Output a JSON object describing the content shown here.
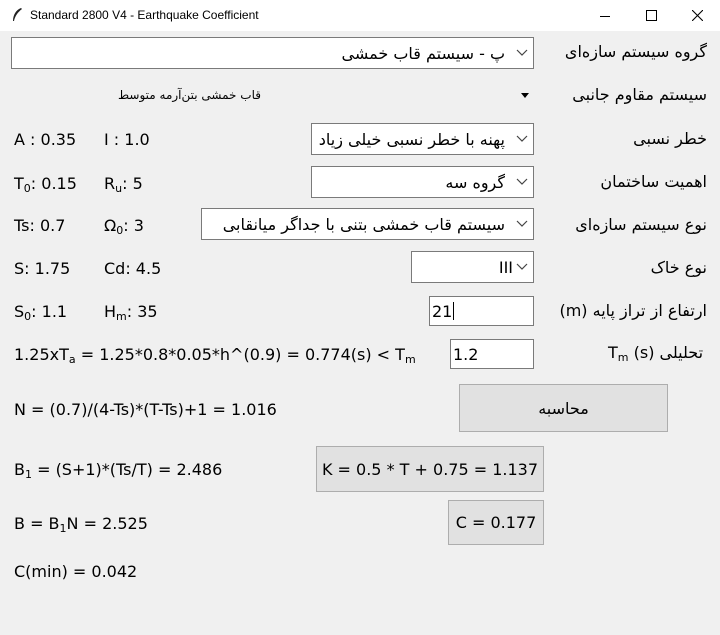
{
  "window": {
    "title": "Standard 2800 V4 - Earthquake Coefficient",
    "min_icon": "minimize-icon",
    "max_icon": "maximize-icon",
    "close_icon": "close-icon"
  },
  "form": {
    "system_group": {
      "label": "گروه سیستم سازه‌ای",
      "value": "پ - سیستم قاب خمشی"
    },
    "lateral_system": {
      "label": "سیستم مقاوم جانبی",
      "value": "قاب خمشی بتن‌آرمه متوسط"
    },
    "relative_hazard": {
      "label": "خطر نسبی",
      "value": "پهنه با خطر نسبی خیلی زیاد"
    },
    "importance": {
      "label": "اهمیت ساختمان",
      "value": "گروه سه"
    },
    "system_type": {
      "label": "نوع سیستم سازه‌ای",
      "value": "سیستم قاب خمشی بتنی با جداگر میانقابی"
    },
    "soil_type": {
      "label": "نوع خاک",
      "value": "III"
    },
    "height": {
      "label": "ارتفاع از تراز پایه (m)",
      "value": "21"
    },
    "analytic_t": {
      "label_prefix": "T",
      "label_sub": "m",
      "label_suffix": "تحلیلی (s)",
      "value": "1.2"
    }
  },
  "params": {
    "A": "A : 0.35",
    "I": "I : 1.0",
    "T0_base": "T",
    "T0_sub": "0",
    "T0_value": ": 0.15",
    "Ru_base": "R",
    "Ru_sub": "u",
    "Ru_value": ": 5",
    "Ts": "Ts: 0.7",
    "Omega_base": "Ω",
    "Omega_sub": "0",
    "Omega_value": ": 3",
    "S": "S: 1.75",
    "Cd": "Cd: 4.5",
    "S0_base": "S",
    "S0_sub": "0",
    "S0_value": ": 1.1",
    "Hm_base": "H",
    "Hm_sub": "m",
    "Hm_value": ": 35"
  },
  "results": {
    "period_prefix": "1.25xT",
    "period_sub_a": "a",
    "period_mid": " = 1.25*0.8*0.05*h^(0.9) = 0.774(s) < T",
    "period_sub_m": "m",
    "N": "N = (0.7)/(4-Ts)*(T-Ts)+1 = 1.016",
    "B1_base": "B",
    "B1_sub": "1",
    "B1_rest": " = (S+1)*(Ts/T) = 2.486",
    "B_prefix": "B = B",
    "B_sub": "1",
    "B_rest": "N = 2.525",
    "Cmin": "C(min) = 0.042"
  },
  "buttons": {
    "calculate": "محاسبه",
    "K": "K = 0.5 * T + 0.75 = 1.137",
    "C": "C = 0.177"
  }
}
